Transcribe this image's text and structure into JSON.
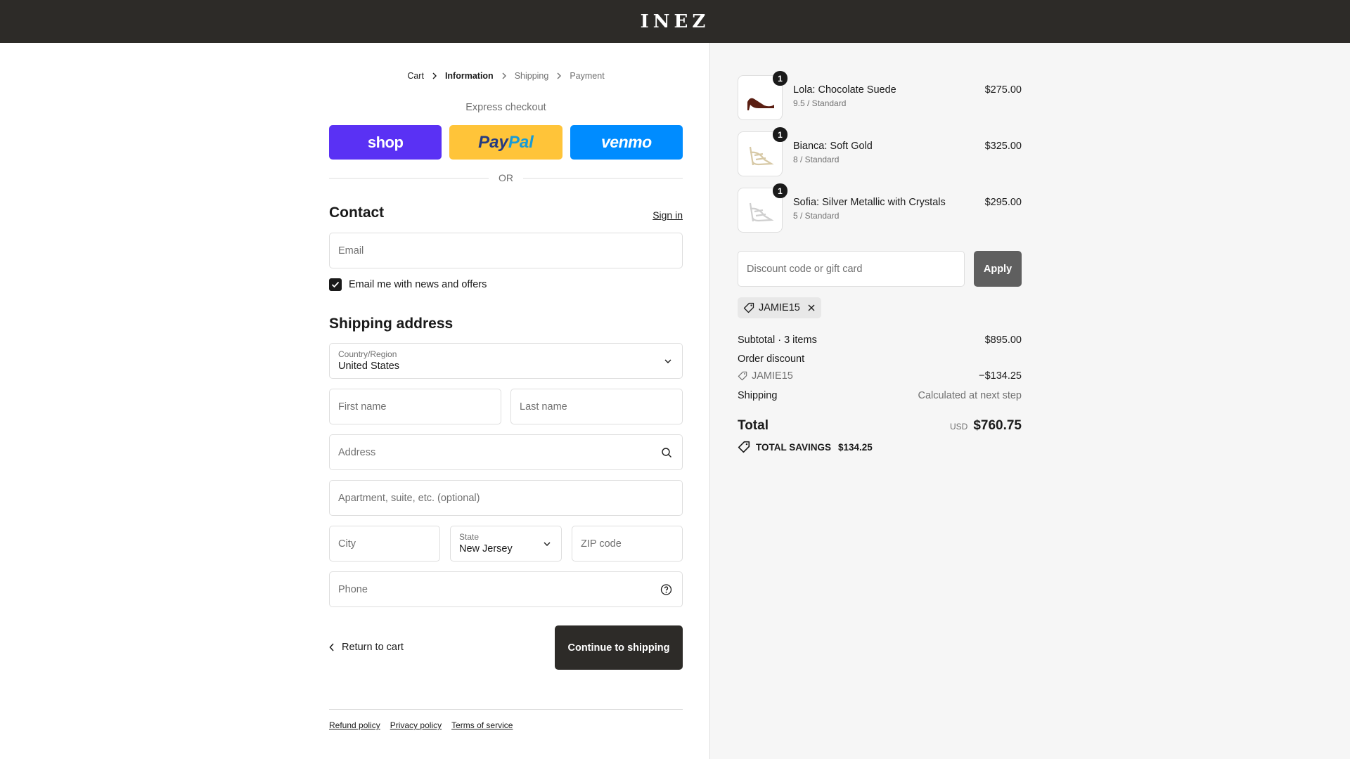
{
  "header": {
    "logo": "INEZ"
  },
  "breadcrumb": [
    {
      "label": "Cart",
      "state": "link"
    },
    {
      "label": "Information",
      "state": "active"
    },
    {
      "label": "Shipping",
      "state": "inactive"
    },
    {
      "label": "Payment",
      "state": "inactive"
    }
  ],
  "express": {
    "title": "Express checkout",
    "shop_label": "shop",
    "paypal_label_1": "Pay",
    "paypal_label_2": "Pal",
    "venmo_label": "venmo",
    "or_label": "OR"
  },
  "contact": {
    "title": "Contact",
    "sign_in": "Sign in",
    "email_placeholder": "Email",
    "newsletter_label": "Email me with news and offers",
    "newsletter_checked": true
  },
  "shipping": {
    "title": "Shipping address",
    "country_label": "Country/Region",
    "country_value": "United States",
    "first_name_placeholder": "First name",
    "last_name_placeholder": "Last name",
    "address_placeholder": "Address",
    "apartment_placeholder": "Apartment, suite, etc. (optional)",
    "city_placeholder": "City",
    "state_label": "State",
    "state_value": "New Jersey",
    "zip_placeholder": "ZIP code",
    "phone_placeholder": "Phone"
  },
  "actions": {
    "return_label": "Return to cart",
    "continue_label": "Continue to shipping"
  },
  "footer": {
    "refund": "Refund policy",
    "privacy": "Privacy policy",
    "terms": "Terms of service"
  },
  "summary": {
    "items": [
      {
        "name": "Lola: Chocolate Suede",
        "variant": "9.5 / Standard",
        "price": "$275.00",
        "qty": "1",
        "shoe_color": "#5a1e12"
      },
      {
        "name": "Bianca: Soft Gold",
        "variant": "8 / Standard",
        "price": "$325.00",
        "qty": "1",
        "shoe_color": "#e6dcc2"
      },
      {
        "name": "Sofia: Silver Metallic with Crystals",
        "variant": "5 / Standard",
        "price": "$295.00",
        "qty": "1",
        "shoe_color": "#e2e2e2"
      }
    ],
    "discount_placeholder": "Discount code or gift card",
    "apply_label": "Apply",
    "applied_code": "JAMIE15",
    "subtotal_label": "Subtotal · 3 items",
    "subtotal_value": "$895.00",
    "order_discount_label": "Order discount",
    "discount_code_label": "JAMIE15",
    "discount_value": "−$134.25",
    "shipping_label": "Shipping",
    "shipping_value": "Calculated at next step",
    "total_label": "Total",
    "currency": "USD",
    "total_value": "$760.75",
    "savings_label": "TOTAL SAVINGS",
    "savings_value": "$134.25"
  },
  "colors": {
    "header_bg": "#2d2b28",
    "shop_pay": "#5a31f4",
    "paypal": "#ffc439",
    "venmo": "#008cff",
    "primary_button": "#2d2b28"
  }
}
